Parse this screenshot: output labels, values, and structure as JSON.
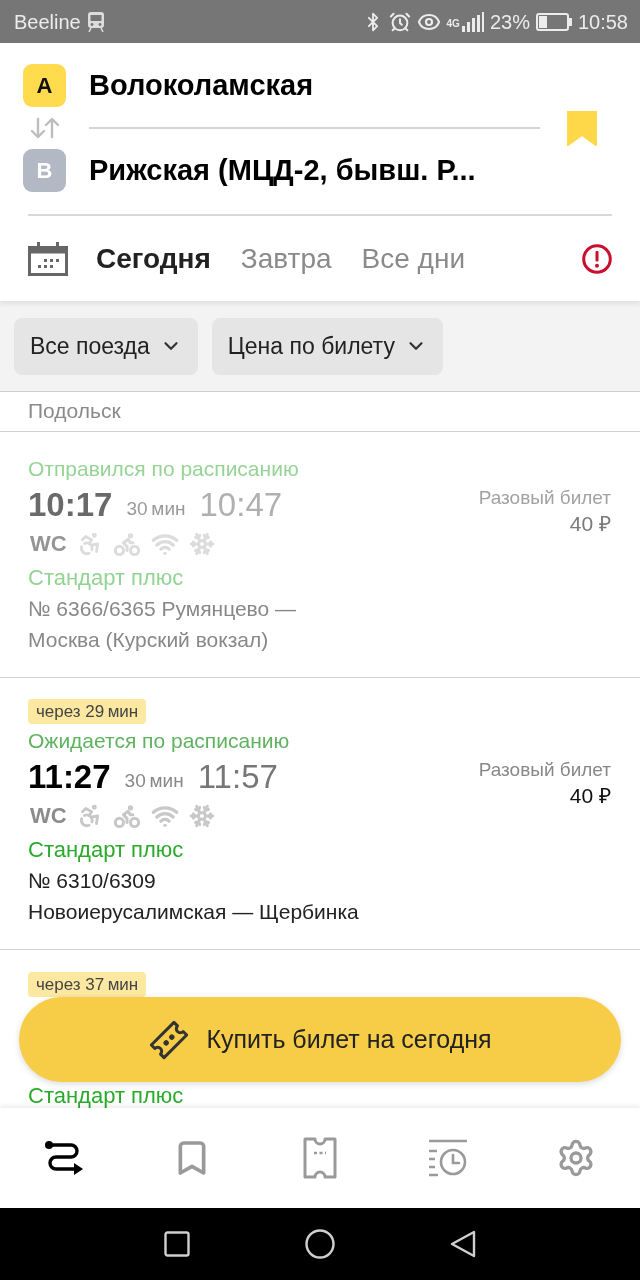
{
  "status_bar": {
    "carrier": "Beeline",
    "network": "4G",
    "battery": "23%",
    "time": "10:58"
  },
  "route": {
    "from": {
      "badge": "A",
      "name": "Волоколамская"
    },
    "to": {
      "badge": "B",
      "name": "Рижская (МЦД-2, бывш. Р..."
    },
    "bookmarked": true
  },
  "date_tabs": [
    {
      "label": "Сегодня",
      "selected": true
    },
    {
      "label": "Завтра",
      "selected": false
    },
    {
      "label": "Все дни",
      "selected": false
    }
  ],
  "filters": [
    {
      "label": "Все поезда"
    },
    {
      "label": "Цена по билету"
    }
  ],
  "trains": [
    {
      "kind": "tail",
      "route": "Подольск"
    },
    {
      "kind": "full",
      "departed": true,
      "status": "Отправился по расписанию",
      "departure": "10:17",
      "duration": "30 мин",
      "arrival": "10:47",
      "wc_sign": "WC",
      "ticket_type": "Разовый билет",
      "price": "40 ₽",
      "train_class": "Стандарт плюс",
      "description": "№ 6366/6365 Румянцево —\nМосква (Курский вокзал)"
    },
    {
      "kind": "full",
      "departed": false,
      "countdown": "через 29 мин",
      "status": "Ожидается по расписанию",
      "departure": "11:27",
      "duration": "30 мин",
      "arrival": "11:57",
      "wc_sign": "WC",
      "ticket_type": "Разовый билет",
      "price": "40 ₽",
      "train_class": "Стандарт плюс",
      "description": "№ 6310/6309\nНовоиерусалимская — Щербинка"
    },
    {
      "kind": "covered",
      "countdown": "через 37 мин",
      "train_class": "Стандарт плюс"
    }
  ],
  "buy_button": {
    "label": "Купить билет на сегодня"
  },
  "bottom_nav": [
    {
      "selected": true
    },
    {
      "selected": false
    },
    {
      "selected": false
    },
    {
      "selected": false
    },
    {
      "selected": false
    }
  ]
}
